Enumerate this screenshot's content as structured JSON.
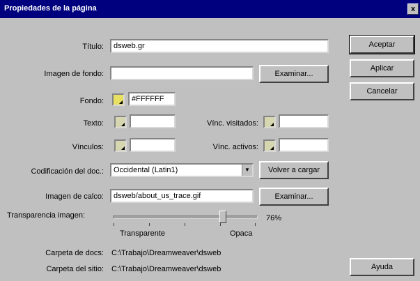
{
  "window": {
    "title": "Propiedades de la página",
    "close_label": "x"
  },
  "buttons": {
    "accept": "Aceptar",
    "apply": "Aplicar",
    "cancel": "Cancelar",
    "help": "Ayuda",
    "browse_background": "Examinar...",
    "reset_encoding": "Volver a cargar",
    "browse_tracing": "Examinar..."
  },
  "fields": {
    "title_label": "Título:",
    "title_value": "dsweb.gr",
    "background_image_label": "Imagen de fondo:",
    "background_image_value": "",
    "background_label": "Fondo:",
    "background_value": "#FFFFFF",
    "text_label": "Texto:",
    "text_value": "",
    "visited_links_label": "Vínc. visitados:",
    "visited_links_value": "",
    "links_label": "Vínculos:",
    "links_value": "",
    "active_links_label": "Vínc. activos:",
    "active_links_value": "",
    "encoding_label": "Codificación del doc.:",
    "encoding_value": "Occidental (Latin1)",
    "tracing_image_label": "Imagen de calco:",
    "tracing_image_value": "dsweb/about_us_trace.gif",
    "transparency_label": "Transparencia imagen:"
  },
  "slider": {
    "percent_label": "76%",
    "left_label": "Transparente",
    "right_label": "Opaca",
    "value_fraction": 0.76
  },
  "info": {
    "doc_folder_label": "Carpeta de docs:",
    "doc_folder_value": "C:\\Trabajo\\Dreamweaver\\dsweb",
    "site_folder_label": "Carpeta del sitio:",
    "site_folder_value": "C:\\Trabajo\\Dreamweaver\\dsweb"
  },
  "colors": {
    "titlebar": "#00007f",
    "dialog": "#c0c0c0",
    "swatch_highlight": "#e8e060"
  }
}
